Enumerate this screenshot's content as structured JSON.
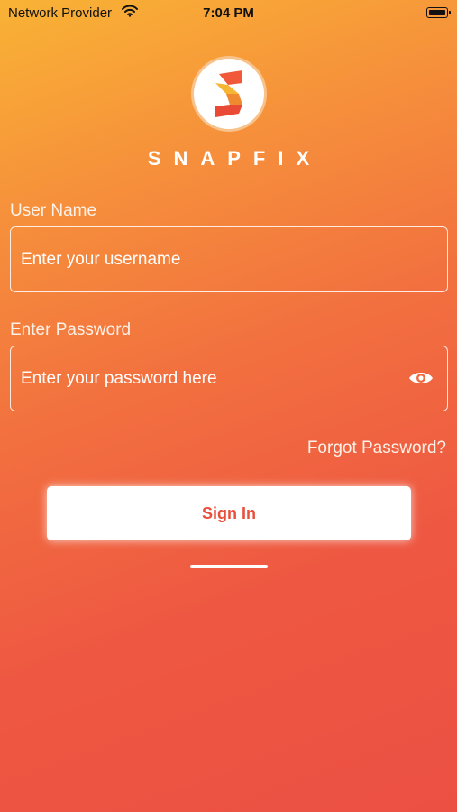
{
  "status_bar": {
    "carrier": "Network Provider",
    "time": "7:04 PM"
  },
  "logo": {
    "icon": "snapfix-s-logo",
    "brand_name": "SNAPFIX"
  },
  "form": {
    "username": {
      "label": "User Name",
      "placeholder": "Enter your username",
      "value": ""
    },
    "password": {
      "label": "Enter Password",
      "placeholder": "Enter your password here",
      "value": "",
      "toggle_icon": "eye-icon"
    },
    "forgot_label": "Forgot Password?",
    "signin_label": "Sign In"
  },
  "colors": {
    "gradient_top": "#f9b335",
    "gradient_bottom": "#ec5043",
    "signin_text": "#e8503c"
  }
}
